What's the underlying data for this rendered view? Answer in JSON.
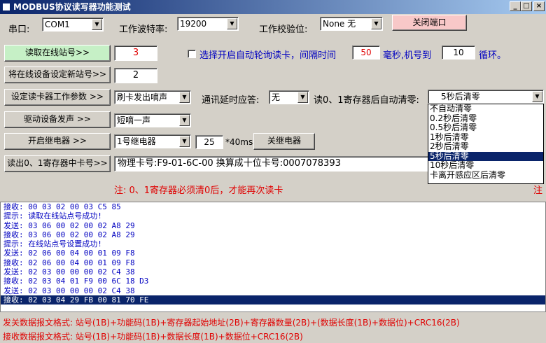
{
  "window": {
    "title": "MODBUS协议读写器功能测试",
    "min_glyph": "_",
    "max_glyph": "□",
    "close_glyph": "×"
  },
  "top": {
    "port_label": "串口:",
    "port_value": "COM1",
    "baud_label": "工作波特率:",
    "baud_value": "19200",
    "parity_label": "工作校验位:",
    "parity_value": "None  无",
    "close_port_button": "关闭端口"
  },
  "rows": {
    "read_station_button": "读取在线站号>>",
    "station_value": "3",
    "auto_poll_label": "选择开启自动轮询读卡，间隔时间",
    "interval_value": "50",
    "interval_unit": "毫秒,机号到",
    "machine_value": "10",
    "loop_label": "循环。",
    "set_station_button": "将在线设备设定新站号>>",
    "new_station_value": "2",
    "set_param_button": "设定读卡器工作参数 >>",
    "beep_mode_value": "刷卡发出嘀声",
    "delay_label": "通讯延时应答:",
    "delay_value": "无",
    "autoclear_label": "读0、1寄存器后自动清零:",
    "autoclear_value": "5秒后清零",
    "buzzer_button": "驱动设备发声 >>",
    "buzzer_value": "短嘀一声",
    "relay_button": "开启继电器 >>",
    "relay_value": "1号继电器",
    "relay_time_value": "25",
    "relay_unit": "*40ms",
    "relay_off_button": "关继电器",
    "read_card_button": "读出0、1寄存器中卡号>>",
    "card_value": "物理卡号:F9-01-6C-00  换算成十位卡号:0007078393",
    "note": "注: 0、1寄存器必须清0后，才能再次读卡",
    "note_right": "注"
  },
  "dropdown": {
    "items": [
      "不自动清零",
      "0.2秒后清零",
      "0.5秒后清零",
      "1秒后清零",
      "2秒后清零",
      "5秒后清零",
      "10秒后清零",
      "卡离开感应区后清零"
    ],
    "selected_index": 5
  },
  "log": {
    "lines": [
      "接收: 00 03 02 00 03 C5 85",
      "提示: 读取在线站点号成功!",
      "发送: 03 06 00 02 00 02 A8 29",
      "接收: 03 06 00 02 00 02 A8 29",
      "提示: 在线站点号设置成功!",
      "发送: 02 06 00 04 00 01 09 F8",
      "接收: 02 06 00 04 00 01 09 F8",
      "发送: 02 03 00 00 00 02 C4 38",
      "接收: 02 03 04 01 F9 00 6C 18 D3",
      "发送: 02 03 00 00 00 02 C4 38",
      "接收: 02 03 04 29 FB 00 81 70 FE"
    ],
    "selected_index": 10
  },
  "footer": {
    "send_format": "发关数据报文格式: 站号(1B)+功能码(1B)+寄存器起始地址(2B)+寄存器数量(2B)+(数据长度(1B)+数据位)+CRC16(2B)",
    "recv_format": "接收数据报文格式: 站号(1B)+功能码(1B)+数据长度(1B)+数据位+CRC16(2B)"
  },
  "colors": {
    "accent": "#0a246a",
    "alert": "#e00000",
    "log_text": "#0000c0",
    "highlight_button": "#c6f0c6",
    "close_button": "#f8c8c8"
  }
}
